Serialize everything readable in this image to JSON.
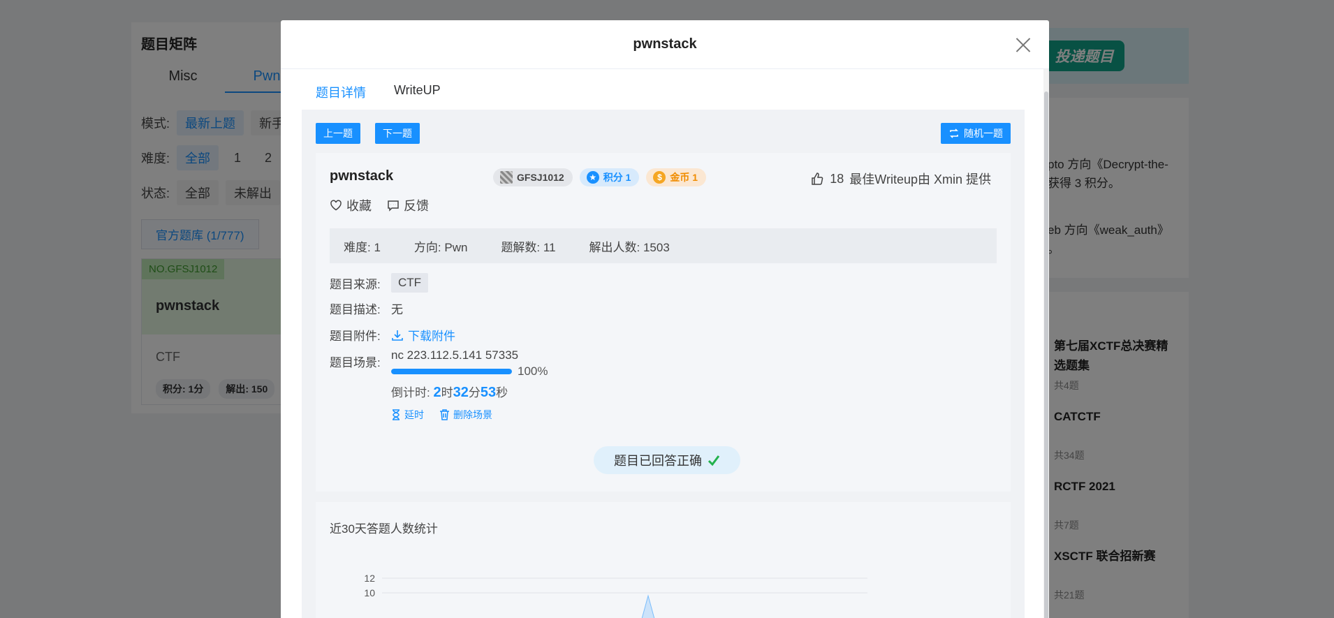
{
  "background": {
    "title": "题目矩阵",
    "tabs": [
      "Misc",
      "Pwn"
    ],
    "mode_label": "模式:",
    "mode_options": [
      "最新上题",
      "新手"
    ],
    "difficulty_label": "难度:",
    "difficulty_options": [
      "全部",
      "1",
      "2"
    ],
    "status_label": "状态:",
    "status_options": [
      "全部",
      "未解出"
    ],
    "official_bank": "官方题库 (1/777)",
    "problem_card": {
      "number": "NO.GFSJ1012",
      "name": "pwnstack",
      "tag": "CTF",
      "badges": [
        "积分: 1分",
        "解出: 150"
      ]
    },
    "banner_button": "投递题目",
    "news": [
      "pto 方向《Decrypt-the-",
      "获得 3 积分。",
      "eb 方向《weak_auth》",
      "。"
    ],
    "sets": [
      {
        "title": "第七届XCTF总决赛精选题集",
        "count": "共4题"
      },
      {
        "title": "CATCTF",
        "count": "共34题"
      },
      {
        "title": "RCTF 2021",
        "count": "共7题"
      },
      {
        "title": "XSCTF 联合招新赛",
        "count": "共21题"
      }
    ]
  },
  "dialog": {
    "title": "pwnstack",
    "tabs": [
      "题目详情",
      "WriteUP"
    ],
    "prev_button": "上一题",
    "next_button": "下一题",
    "random_button": "随机一题",
    "problem": {
      "name": "pwnstack",
      "id_badge": "GFSJ1012",
      "score_badge": "积分 1",
      "coin_badge": "金币 1",
      "likes": "18",
      "best_writeup": "最佳Writeup由 Xmin 提供",
      "collect": "收藏",
      "feedback": "反馈",
      "stats": {
        "difficulty": "难度: 1",
        "direction": "方向: Pwn",
        "writeups": "题解数: 11",
        "solvers": "解出人数: 1503"
      },
      "source_label": "题目来源:",
      "source_value": "CTF",
      "desc_label": "题目描述:",
      "desc_value": "无",
      "attach_label": "题目附件:",
      "attach_link": "下载附件",
      "scene_label": "题目场景:",
      "scene_addr": "nc 223.112.5.141 57335",
      "scene_progress": 100,
      "scene_progress_text": "100%",
      "countdown_prefix": "倒计时: ",
      "countdown_h": "2",
      "countdown_h_unit": "时",
      "countdown_m": "32",
      "countdown_m_unit": "分",
      "countdown_s": "53",
      "countdown_s_unit": "秒",
      "extend": "延时",
      "delete_scene": "删除场景",
      "solved_text": "题目已回答正确"
    },
    "chart_title": "近30天答题人数统计"
  },
  "chart_data": {
    "type": "area",
    "title": "近30天答题人数统计",
    "y_ticks": [
      "12",
      "10"
    ],
    "ylim": [
      0,
      12
    ],
    "grid": true,
    "legend": "none",
    "color": "#1890ff"
  }
}
